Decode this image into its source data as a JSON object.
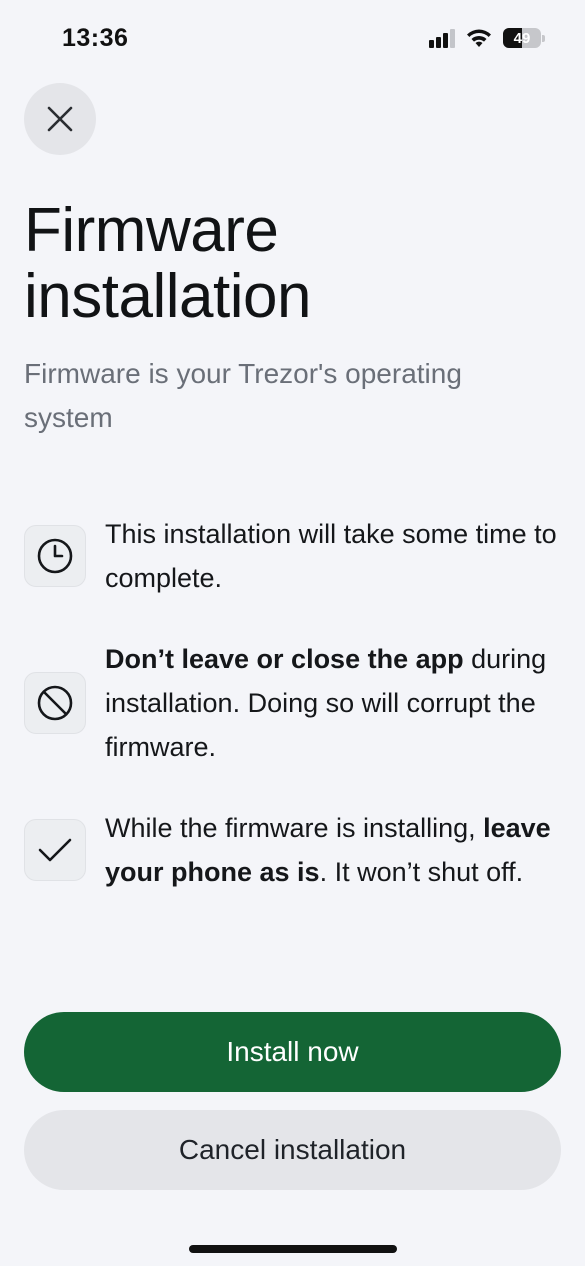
{
  "status_bar": {
    "time": "13:36",
    "battery_level": "49"
  },
  "header": {
    "close_icon": "close-icon"
  },
  "title": "Firmware installation",
  "subtitle": "Firmware is your Trezor's operating system",
  "info_items": [
    {
      "icon": "clock-icon",
      "text": "This installation will take some time to complete."
    },
    {
      "icon": "prohibited-icon",
      "bold": "Don’t leave or close the app",
      "text": " during installation. Doing so will corrupt the firmware."
    },
    {
      "icon": "check-icon",
      "text_before": "While the firmware is installing, ",
      "bold": "leave your phone as is",
      "text_after": ". It won’t shut off."
    }
  ],
  "actions": {
    "install_label": "Install now",
    "cancel_label": "Cancel installation"
  },
  "colors": {
    "primary": "#146535",
    "background": "#f4f5f9",
    "secondary_button": "#e4e5e9"
  }
}
